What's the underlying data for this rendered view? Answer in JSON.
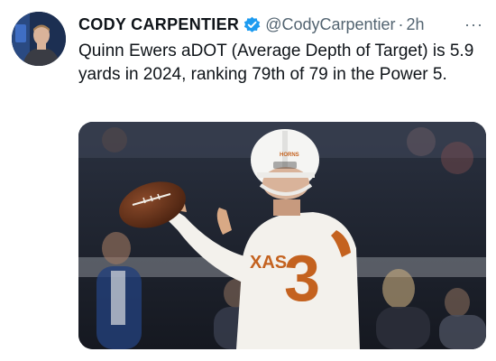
{
  "tweet": {
    "author_name": "CODY CARPENTIER",
    "handle": "@CodyCarpentier",
    "separator": "·",
    "timestamp": "2h",
    "more_label": "···",
    "text": "Quinn Ewers aDOT (Average Depth of Target) is 5.9 yards in 2024, ranking 79th of 79 in the Power 5."
  },
  "media": {
    "helmet_logo": "HORNS",
    "jersey_chest": "XAS",
    "jersey_number": "3"
  },
  "colors": {
    "text_primary": "#0f1419",
    "text_secondary": "#536471",
    "verified_blue": "#1d9bf0",
    "burnt_orange": "#c4621f"
  },
  "icons": {
    "verified": "verified-badge-icon",
    "more": "more-dots-icon"
  }
}
